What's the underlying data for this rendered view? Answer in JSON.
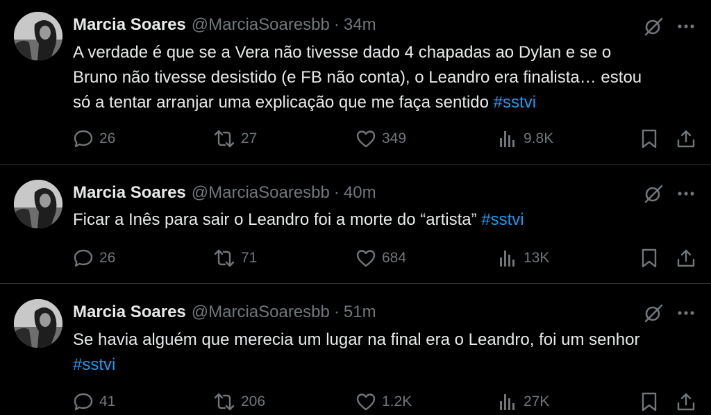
{
  "colors": {
    "background": "#000000",
    "text": "#e7e9ea",
    "muted": "#71767b",
    "link": "#1d9bf0",
    "divider": "#2f3336"
  },
  "icons": [
    "grok-icon",
    "more-icon",
    "reply-icon",
    "repost-icon",
    "like-icon",
    "views-icon",
    "bookmark-icon",
    "share-icon"
  ],
  "tweets": [
    {
      "name": "Marcia Soares",
      "handle": "@MarciaSoaresbb",
      "separator": "·",
      "time": "34m",
      "text": "A verdade é que se a Vera não tivesse dado 4 chapadas ao Dylan e se o\nBruno não tivesse desistido (e FB não conta), o Leandro era finalista… estou\nsó a tentar arranjar uma explicação que me faça sentido ",
      "hashtag": "#sstvi",
      "replies": "26",
      "reposts": "27",
      "likes": "349",
      "views": "9.8K"
    },
    {
      "name": "Marcia Soares",
      "handle": "@MarciaSoaresbb",
      "separator": "·",
      "time": "40m",
      "text": "Ficar a Inês para sair o Leandro foi a morte do “artista” ",
      "hashtag": "#sstvi",
      "replies": "26",
      "reposts": "71",
      "likes": "684",
      "views": "13K"
    },
    {
      "name": "Marcia Soares",
      "handle": "@MarciaSoaresbb",
      "separator": "·",
      "time": "51m",
      "text": "Se havia alguém que merecia um lugar na final era o Leandro, foi um senhor\n",
      "hashtag": "#sstvi",
      "replies": "41",
      "reposts": "206",
      "likes": "1.2K",
      "views": "27K"
    }
  ]
}
